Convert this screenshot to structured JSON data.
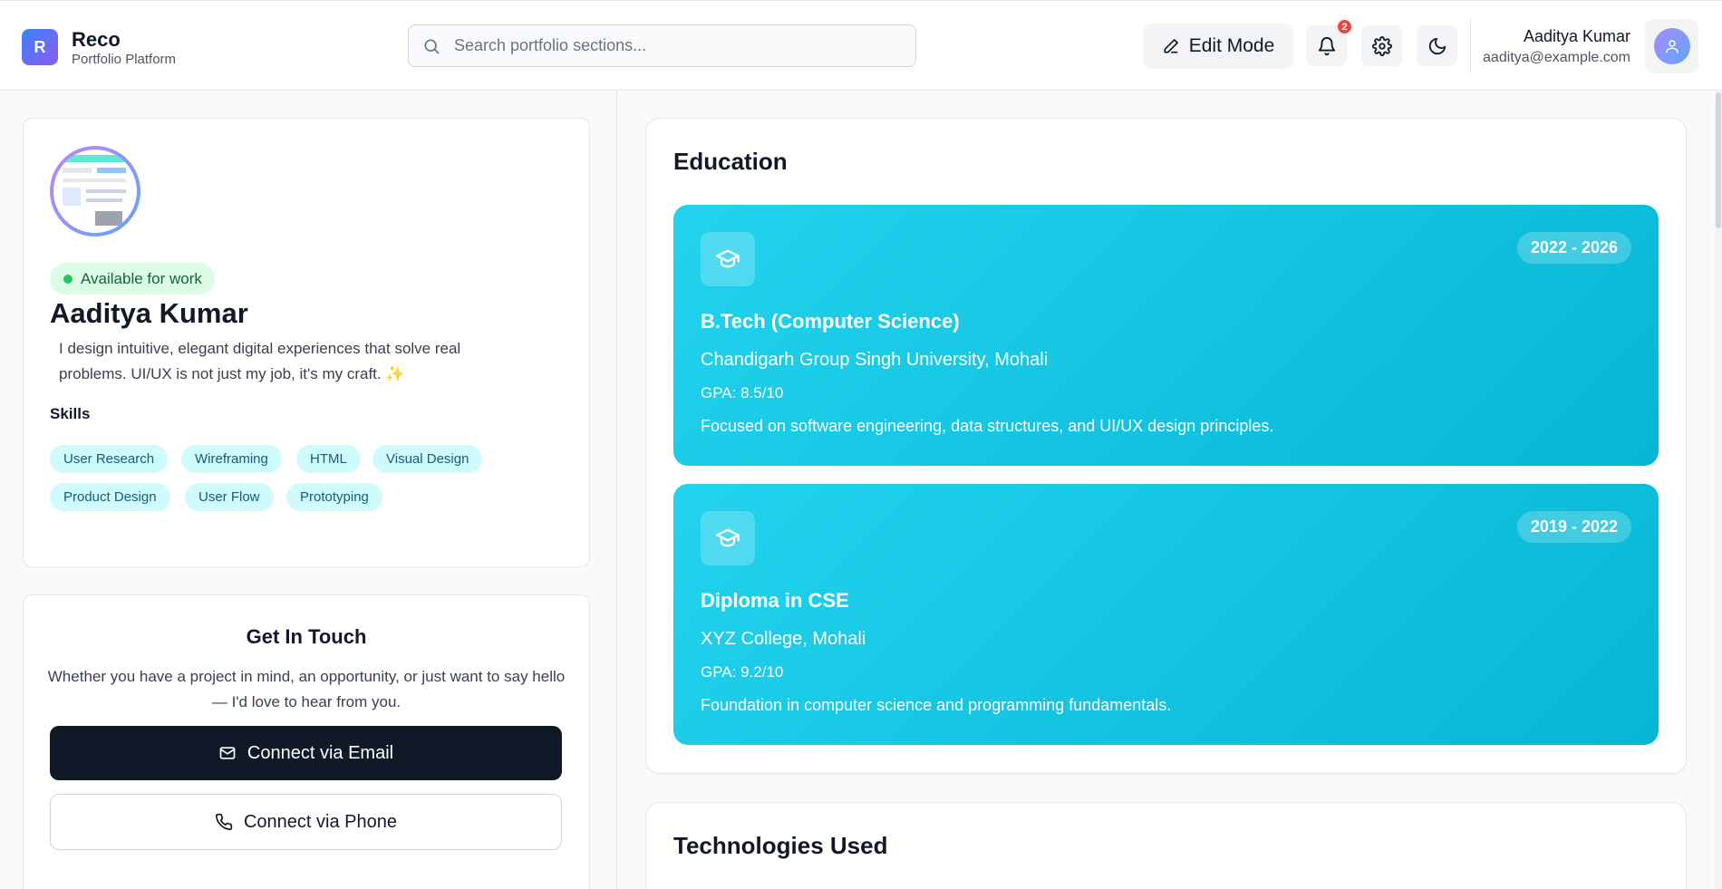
{
  "brand": {
    "logo_letter": "R",
    "name": "Reco",
    "subtitle": "Portfolio Platform"
  },
  "search": {
    "placeholder": "Search portfolio sections..."
  },
  "header": {
    "edit_label": "Edit Mode",
    "notification_count": "2",
    "user_name": "Aaditya Kumar",
    "user_email": "aaditya@example.com"
  },
  "profile": {
    "status": "Available for work",
    "name": "Aaditya Kumar",
    "bio": "I design intuitive, elegant digital experiences that solve real problems. UI/UX is not just my job, it's my craft. ✨",
    "skills_label": "Skills",
    "skills": [
      "User Research",
      "Wireframing",
      "HTML",
      "Visual Design",
      "Product Design",
      "User Flow",
      "Prototyping"
    ]
  },
  "contact": {
    "title": "Get In Touch",
    "description": "Whether you have a project in mind, an opportunity, or just want to say hello — I'd love to hear from you.",
    "email_label": "Connect via Email",
    "phone_label": "Connect via Phone"
  },
  "education": {
    "title": "Education",
    "items": [
      {
        "years": "2022 - 2026",
        "degree": "B.Tech (Computer Science)",
        "school": "Chandigarh Group Singh University, Mohali",
        "gpa": "GPA: 8.5/10",
        "description": "Focused on software engineering, data structures, and UI/UX design principles."
      },
      {
        "years": "2019 - 2022",
        "degree": "Diploma in CSE",
        "school": "XYZ College, Mohali",
        "gpa": "GPA: 9.2/10",
        "description": "Foundation in computer science and programming fundamentals."
      }
    ]
  },
  "technologies": {
    "title": "Technologies Used"
  },
  "colors": {
    "accent_cyan": "#06b6d4",
    "dark_button": "#111827",
    "available_green": "#22c55e",
    "badge_red": "#ef4444"
  },
  "icons": [
    "search-icon",
    "pencil-icon",
    "bell-icon",
    "gear-icon",
    "moon-icon",
    "user-icon",
    "graduation-cap-icon",
    "mail-icon",
    "phone-icon"
  ]
}
